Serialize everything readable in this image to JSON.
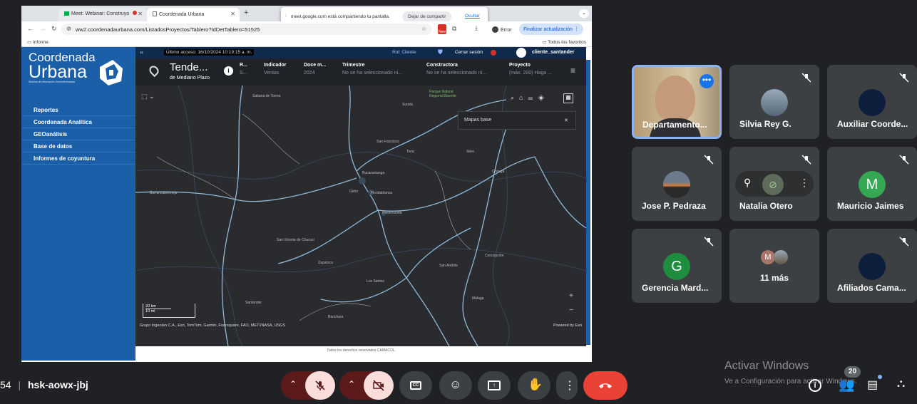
{
  "browser": {
    "tabs": [
      {
        "label": "Meet: Webinar: Construyo"
      },
      {
        "label": "Coordenada Urbana"
      }
    ],
    "url": "ww2.coordenadaurbana.com/ListadosProyectos/Tablero?IdDetTablero=51525",
    "new_badge": "New",
    "error_label": "Error",
    "update_label": "Finalizar actualización",
    "bookmark": "Informe",
    "all_bookmarks": "Todos los favoritos"
  },
  "share_banner": {
    "text": "meet.google.com está compartiendo tu pantalla.",
    "stop": "Dejar de compartir",
    "hide": "Ocultar"
  },
  "app": {
    "logo_line1": "Coordenada",
    "logo_line2": "Urbana",
    "logo_sub": "Sistema de Información Georreferenciada",
    "last_access": "Último acceso: 16/10/2024 10:19:15 a. m.",
    "role": "Rol: Cliente",
    "logout": "Cerrar sesión",
    "user": "cliente_santander",
    "menu": [
      "Reportes",
      "Coordenada Analítica",
      "GEOanálisis",
      "Base de datos",
      "Informes de coyuntura"
    ],
    "title": "Tende...",
    "subtitle": "de Mediano Plazo",
    "filters": [
      {
        "h": "R...",
        "v": "S..."
      },
      {
        "h": "Indicador",
        "v": "Ventas"
      },
      {
        "h": "Doce m...",
        "v": "2024"
      },
      {
        "h": "Trimestre",
        "v": "No se ha seleccionado ni..."
      },
      {
        "h": "Constructora",
        "v": "No se ha seleccionado ni..."
      },
      {
        "h": "Proyecto",
        "v": "(máx. 200) Haga ..."
      }
    ],
    "basemaps": "Mapas base",
    "scale_km": "20 km",
    "scale_mi": "10 mi",
    "attribution": "Grupo Ingeolan C.A., Esri, TomTom, Garmin, Foursquare, FAO, METI/NASA, USGS",
    "powered": "Powered by Esri",
    "footer": "Todos los derechos reservados CAMACOL",
    "map_labels": [
      "Sabana de Torres",
      "Suratá",
      "Parque Natural Regional Bisonte",
      "Barrancabermeja",
      "San Francisco",
      "Tona",
      "Silos",
      "Bucaramanga",
      "Girón",
      "Floridablanca",
      "Piedecuesta",
      "Chitagá",
      "San Vicente de Chucurí",
      "Zapatoca",
      "San Andrés",
      "Los Santos",
      "Santander",
      "Barichara",
      "Málaga",
      "Concepción"
    ]
  },
  "participants": [
    {
      "name": "Departamento..."
    },
    {
      "name": "Silvia Rey G."
    },
    {
      "name": "Auxiliar Coorde..."
    },
    {
      "name": "Jose P. Pedraza"
    },
    {
      "name": "Natalia Otero"
    },
    {
      "name": "Mauricio Jaimes",
      "initial": "M"
    },
    {
      "name": "Gerencia Mard...",
      "initial": "G"
    },
    {
      "name": "11 más",
      "initial": "M"
    },
    {
      "name": "Afiliados Cama..."
    }
  ],
  "meeting": {
    "time": "54",
    "code": "hsk-aowx-jbj",
    "people_count": "20"
  },
  "watermark": {
    "title": "Activar Windows",
    "text": "Ve a Configuración para activar Windows."
  },
  "colors": {
    "meet_bg": "#202124",
    "end_call": "#ea4335",
    "muted_btn": "#f9dedc",
    "sidebar": "#1b5fa8"
  }
}
